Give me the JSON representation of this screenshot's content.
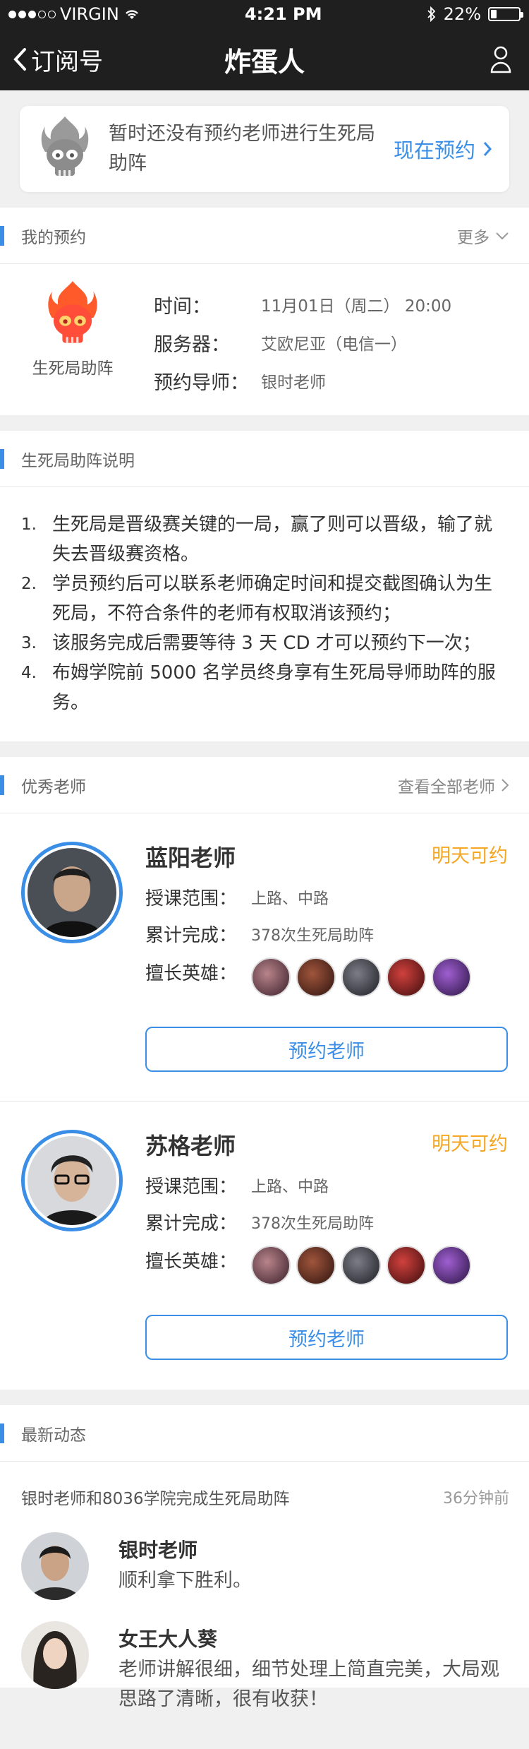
{
  "status_bar": {
    "carrier": "VIRGIN",
    "time": "4:21 PM",
    "battery": "22%",
    "battery_level": 0.22
  },
  "nav": {
    "back_label": "订阅号",
    "title": "炸蛋人"
  },
  "notice": {
    "text": "暂时还没有预约老师进行生死局助阵",
    "action": "现在预约"
  },
  "my_booking": {
    "section_title": "我的预约",
    "more": "更多",
    "icon_label": "生死局助阵",
    "rows": [
      {
        "key": "时间：",
        "value": "11月01日（周二） 20:00"
      },
      {
        "key": "服务器：",
        "value": "艾欧尼亚（电信一）"
      },
      {
        "key": "预约导师：",
        "value": "银时老师"
      }
    ]
  },
  "rules": {
    "section_title": "生死局助阵说明",
    "items": [
      {
        "n": "1.",
        "text": "生死局是晋级赛关键的一局，赢了则可以晋级，输了就失去晋级赛资格。"
      },
      {
        "n": "2.",
        "text": "学员预约后可以联系老师确定时间和提交截图确认为生死局，不符合条件的老师有权取消该预约；"
      },
      {
        "n": "3.",
        "text": "该服务完成后需要等待 3 天 CD 才可以预约下一次；"
      },
      {
        "n": "4.",
        "text": "布姆学院前 5000 名学员终身享有生死局导师助阵的服务。"
      }
    ]
  },
  "teachers": {
    "section_title": "优秀老师",
    "more": "查看全部老师",
    "list": [
      {
        "name": "蓝阳老师",
        "status": "明天可约",
        "range_key": "授课范围：",
        "range": "上路、中路",
        "done_key": "累计完成：",
        "done": "378次生死局助阵",
        "heroes_key": "擅长英雄：",
        "button": "预约老师"
      },
      {
        "name": "苏格老师",
        "status": "明天可约",
        "range_key": "授课范围：",
        "range": "上路、中路",
        "done_key": "累计完成：",
        "done": "378次生死局助阵",
        "heroes_key": "擅长英雄：",
        "button": "预约老师"
      }
    ]
  },
  "news": {
    "section_title": "最新动态",
    "headline": "银时老师和8036学院完成生死局助阵",
    "time": "36分钟前",
    "comments": [
      {
        "name": "银时老师",
        "text": "顺利拿下胜利。"
      },
      {
        "name": "女王大人葵",
        "text": "老师讲解很细，细节处理上简直完美，大局观思路了清晰，很有收获！"
      }
    ]
  },
  "colors": {
    "accent": "#3a8ee6",
    "status_orange": "#f5a623",
    "dark_bar": "#1f1f1f"
  }
}
